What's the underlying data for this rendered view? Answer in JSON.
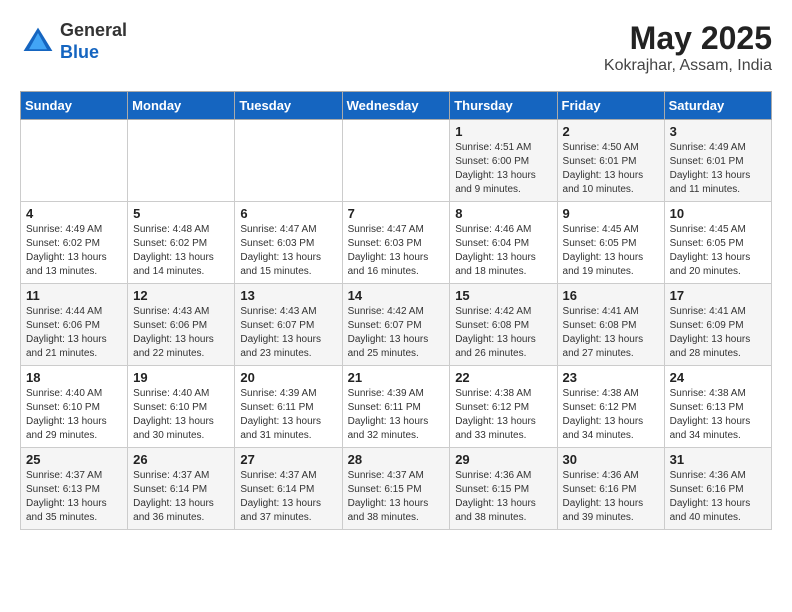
{
  "header": {
    "logo_general": "General",
    "logo_blue": "Blue",
    "month_year": "May 2025",
    "location": "Kokrajhar, Assam, India"
  },
  "days_of_week": [
    "Sunday",
    "Monday",
    "Tuesday",
    "Wednesday",
    "Thursday",
    "Friday",
    "Saturday"
  ],
  "weeks": [
    [
      {
        "day": "",
        "info": ""
      },
      {
        "day": "",
        "info": ""
      },
      {
        "day": "",
        "info": ""
      },
      {
        "day": "",
        "info": ""
      },
      {
        "day": "1",
        "info": "Sunrise: 4:51 AM\nSunset: 6:00 PM\nDaylight: 13 hours\nand 9 minutes."
      },
      {
        "day": "2",
        "info": "Sunrise: 4:50 AM\nSunset: 6:01 PM\nDaylight: 13 hours\nand 10 minutes."
      },
      {
        "day": "3",
        "info": "Sunrise: 4:49 AM\nSunset: 6:01 PM\nDaylight: 13 hours\nand 11 minutes."
      }
    ],
    [
      {
        "day": "4",
        "info": "Sunrise: 4:49 AM\nSunset: 6:02 PM\nDaylight: 13 hours\nand 13 minutes."
      },
      {
        "day": "5",
        "info": "Sunrise: 4:48 AM\nSunset: 6:02 PM\nDaylight: 13 hours\nand 14 minutes."
      },
      {
        "day": "6",
        "info": "Sunrise: 4:47 AM\nSunset: 6:03 PM\nDaylight: 13 hours\nand 15 minutes."
      },
      {
        "day": "7",
        "info": "Sunrise: 4:47 AM\nSunset: 6:03 PM\nDaylight: 13 hours\nand 16 minutes."
      },
      {
        "day": "8",
        "info": "Sunrise: 4:46 AM\nSunset: 6:04 PM\nDaylight: 13 hours\nand 18 minutes."
      },
      {
        "day": "9",
        "info": "Sunrise: 4:45 AM\nSunset: 6:05 PM\nDaylight: 13 hours\nand 19 minutes."
      },
      {
        "day": "10",
        "info": "Sunrise: 4:45 AM\nSunset: 6:05 PM\nDaylight: 13 hours\nand 20 minutes."
      }
    ],
    [
      {
        "day": "11",
        "info": "Sunrise: 4:44 AM\nSunset: 6:06 PM\nDaylight: 13 hours\nand 21 minutes."
      },
      {
        "day": "12",
        "info": "Sunrise: 4:43 AM\nSunset: 6:06 PM\nDaylight: 13 hours\nand 22 minutes."
      },
      {
        "day": "13",
        "info": "Sunrise: 4:43 AM\nSunset: 6:07 PM\nDaylight: 13 hours\nand 23 minutes."
      },
      {
        "day": "14",
        "info": "Sunrise: 4:42 AM\nSunset: 6:07 PM\nDaylight: 13 hours\nand 25 minutes."
      },
      {
        "day": "15",
        "info": "Sunrise: 4:42 AM\nSunset: 6:08 PM\nDaylight: 13 hours\nand 26 minutes."
      },
      {
        "day": "16",
        "info": "Sunrise: 4:41 AM\nSunset: 6:08 PM\nDaylight: 13 hours\nand 27 minutes."
      },
      {
        "day": "17",
        "info": "Sunrise: 4:41 AM\nSunset: 6:09 PM\nDaylight: 13 hours\nand 28 minutes."
      }
    ],
    [
      {
        "day": "18",
        "info": "Sunrise: 4:40 AM\nSunset: 6:10 PM\nDaylight: 13 hours\nand 29 minutes."
      },
      {
        "day": "19",
        "info": "Sunrise: 4:40 AM\nSunset: 6:10 PM\nDaylight: 13 hours\nand 30 minutes."
      },
      {
        "day": "20",
        "info": "Sunrise: 4:39 AM\nSunset: 6:11 PM\nDaylight: 13 hours\nand 31 minutes."
      },
      {
        "day": "21",
        "info": "Sunrise: 4:39 AM\nSunset: 6:11 PM\nDaylight: 13 hours\nand 32 minutes."
      },
      {
        "day": "22",
        "info": "Sunrise: 4:38 AM\nSunset: 6:12 PM\nDaylight: 13 hours\nand 33 minutes."
      },
      {
        "day": "23",
        "info": "Sunrise: 4:38 AM\nSunset: 6:12 PM\nDaylight: 13 hours\nand 34 minutes."
      },
      {
        "day": "24",
        "info": "Sunrise: 4:38 AM\nSunset: 6:13 PM\nDaylight: 13 hours\nand 34 minutes."
      }
    ],
    [
      {
        "day": "25",
        "info": "Sunrise: 4:37 AM\nSunset: 6:13 PM\nDaylight: 13 hours\nand 35 minutes."
      },
      {
        "day": "26",
        "info": "Sunrise: 4:37 AM\nSunset: 6:14 PM\nDaylight: 13 hours\nand 36 minutes."
      },
      {
        "day": "27",
        "info": "Sunrise: 4:37 AM\nSunset: 6:14 PM\nDaylight: 13 hours\nand 37 minutes."
      },
      {
        "day": "28",
        "info": "Sunrise: 4:37 AM\nSunset: 6:15 PM\nDaylight: 13 hours\nand 38 minutes."
      },
      {
        "day": "29",
        "info": "Sunrise: 4:36 AM\nSunset: 6:15 PM\nDaylight: 13 hours\nand 38 minutes."
      },
      {
        "day": "30",
        "info": "Sunrise: 4:36 AM\nSunset: 6:16 PM\nDaylight: 13 hours\nand 39 minutes."
      },
      {
        "day": "31",
        "info": "Sunrise: 4:36 AM\nSunset: 6:16 PM\nDaylight: 13 hours\nand 40 minutes."
      }
    ]
  ]
}
